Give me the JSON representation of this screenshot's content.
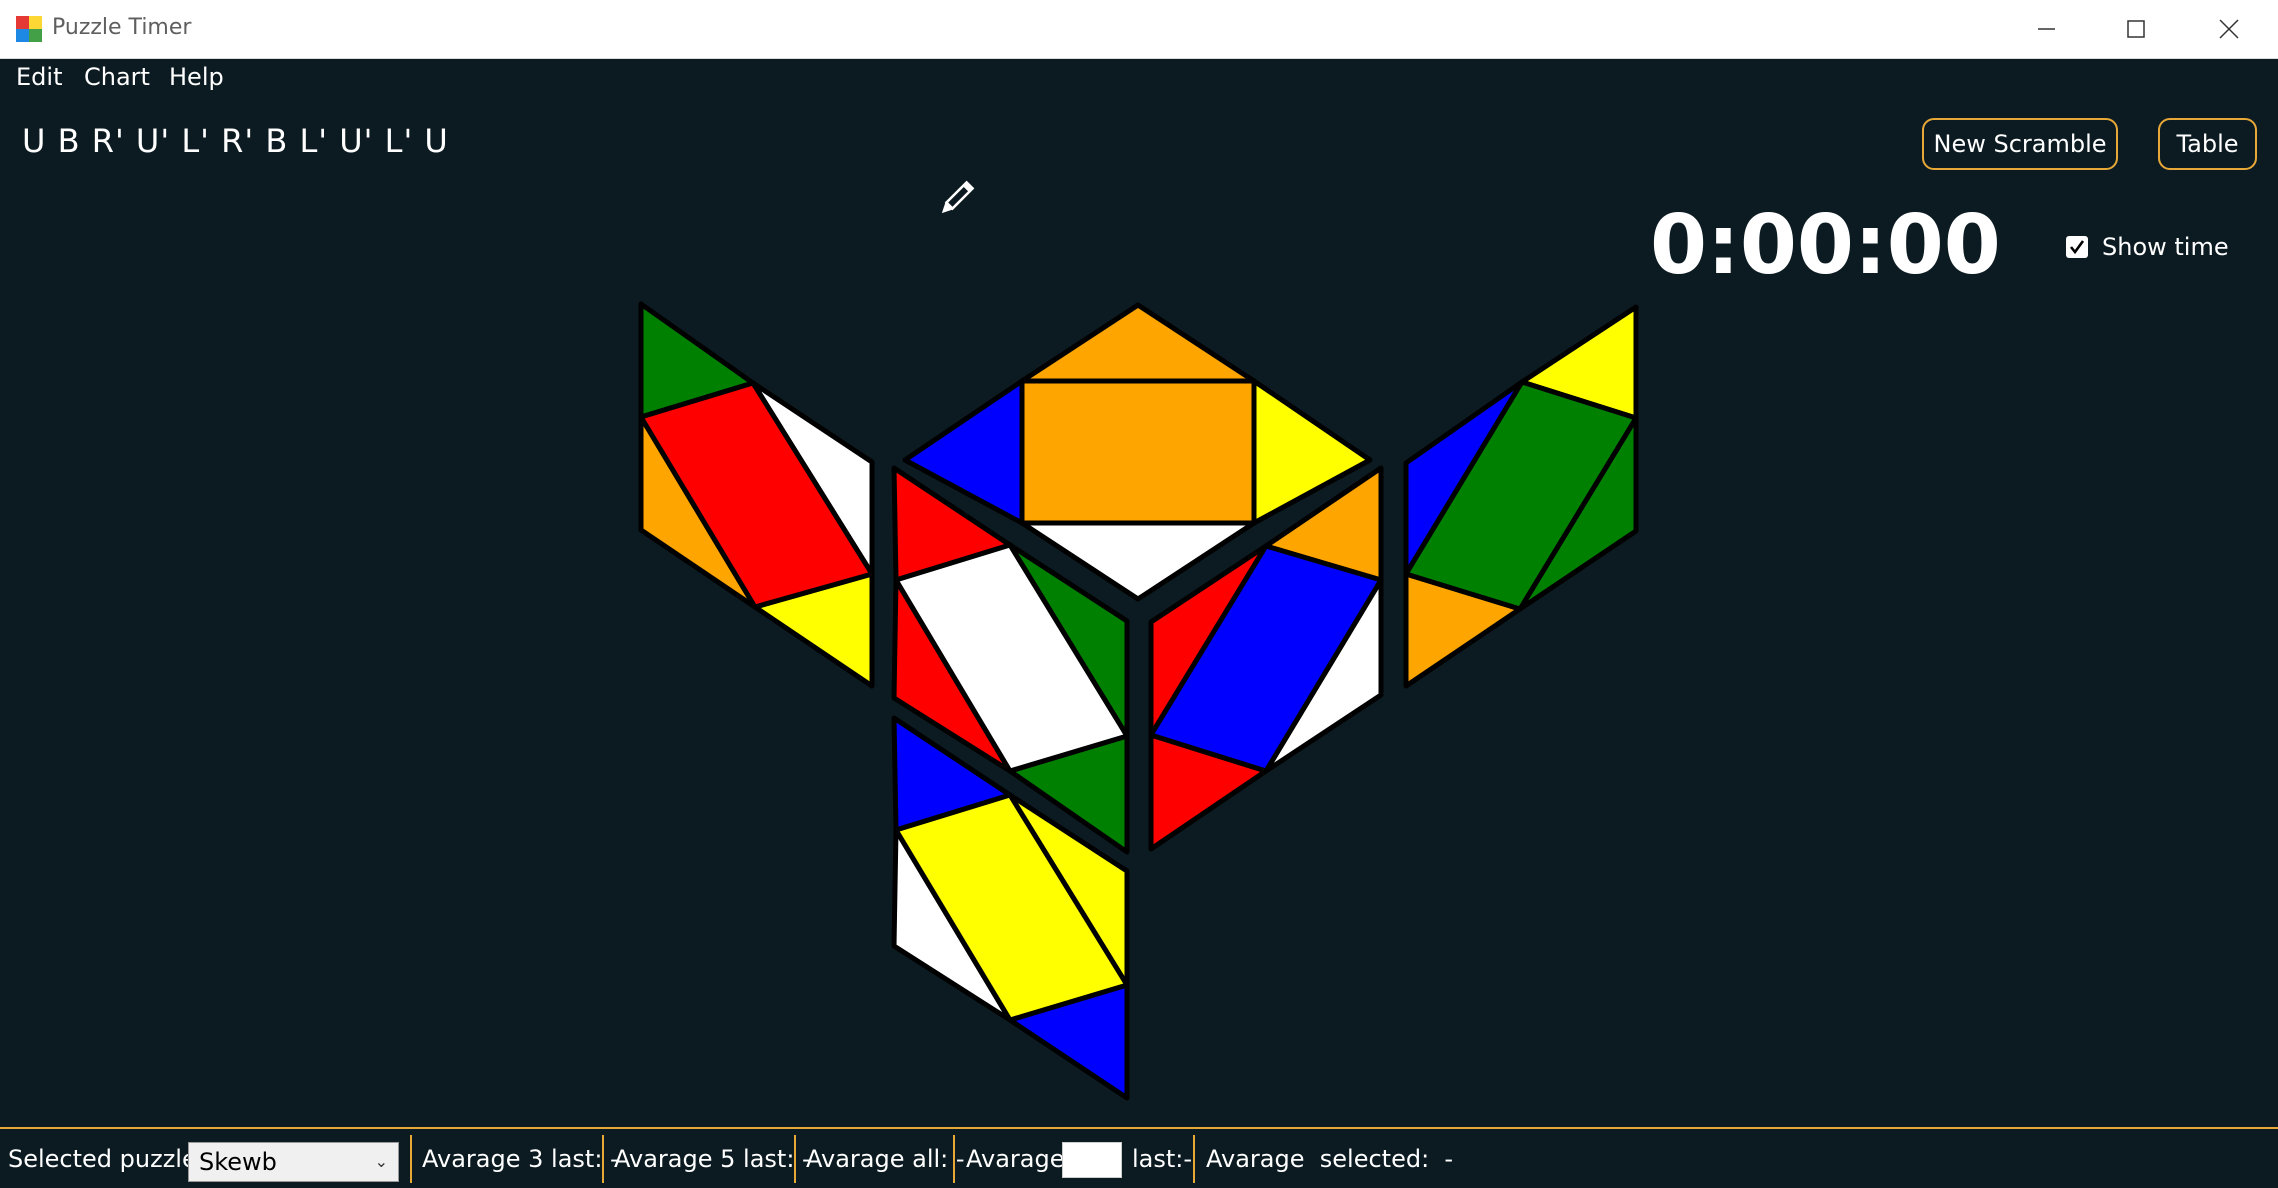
{
  "window": {
    "title": "Puzzle Timer"
  },
  "menu": {
    "items": [
      "Edit",
      "Chart",
      "Help"
    ]
  },
  "scramble": "U B R' U' L' R' B L' U' L' U",
  "buttons": {
    "new_scramble": "New Scramble",
    "table": "Table"
  },
  "timer": {
    "display": "0:00:00",
    "show_time_label": "Show time",
    "show_time_checked": true
  },
  "status": {
    "selected_puzzle_label": "Selected puzzle:",
    "selected_puzzle_value": "Skewb",
    "avg3": "Avarage 3 last: -",
    "avg5": "Avarage 5 last: -",
    "avg_all": "Avarage all: -",
    "avg_custom_prefix": "Avarage",
    "avg_custom_input": "",
    "avg_custom_suffix": "last:-",
    "avg_selected": "Avarage  selected:  -"
  },
  "colors": {
    "background": "#0c1b22",
    "accent": "#e8a838",
    "green": "#008000",
    "red": "#ff0000",
    "white": "#ffffff",
    "orange": "#ffa500",
    "yellow": "#ffff00",
    "blue": "#0000ff"
  },
  "icons": {
    "edit": "pencil-icon",
    "app": "app-icon"
  }
}
